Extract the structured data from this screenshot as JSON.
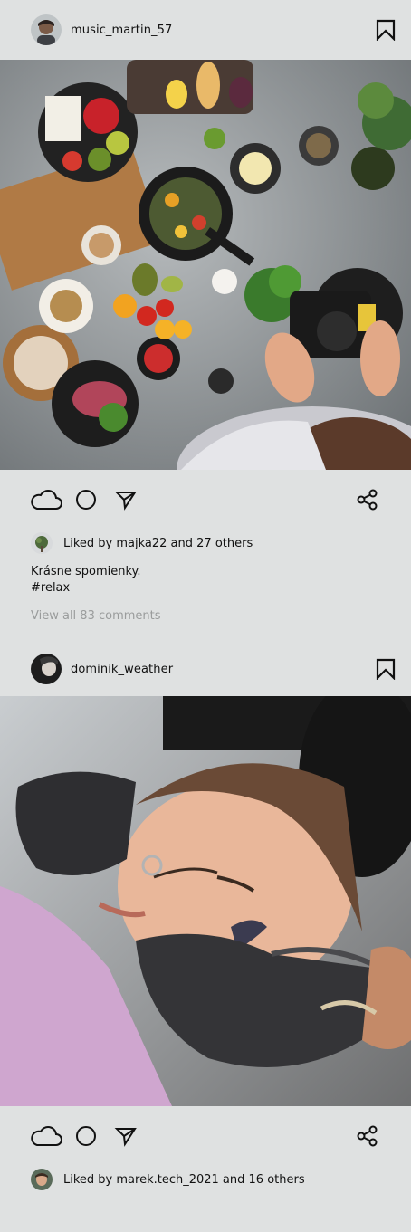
{
  "posts": [
    {
      "username": "music_martin_57",
      "liked_by_text": "Liked by majka22 and 27 others",
      "caption_line1": "Krásne spomienky.",
      "caption_line2": "#relax",
      "view_comments": "View all 83 comments"
    },
    {
      "username": "dominik_weather",
      "liked_by_text": "Liked by marek.tech_2021 and 16 others"
    }
  ],
  "icons": {
    "bookmark": "bookmark-icon",
    "like": "cloud-icon",
    "comment": "circle-icon",
    "send": "send-icon",
    "share": "share-icon"
  }
}
